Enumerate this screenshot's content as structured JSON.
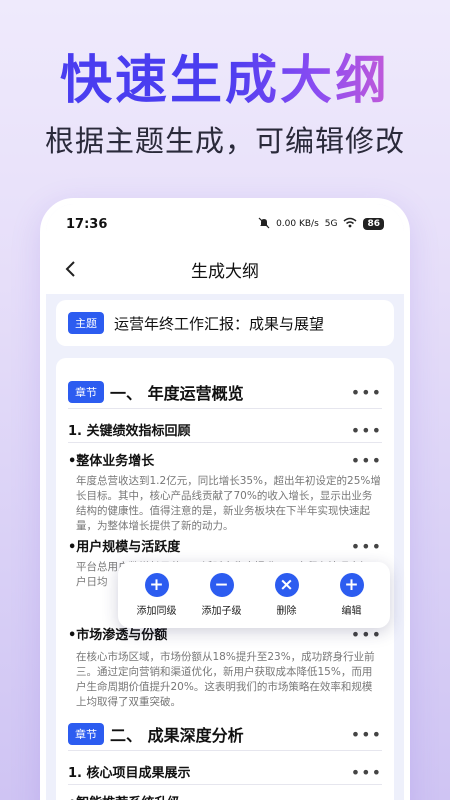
{
  "hero": {
    "title_a": "快速生",
    "title_b": "成大纲",
    "subtitle": "根据主题生成，可编辑修改"
  },
  "status": {
    "time": "17:36",
    "speed": "0.00 KB/s",
    "network": "5G",
    "battery": "86"
  },
  "nav": {
    "title": "生成大纲",
    "back_icon": "chevron-left-icon"
  },
  "topic": {
    "tag": "主题",
    "text": "运营年终工作汇报：成果与展望"
  },
  "outline": {
    "chapter_tag": "章节",
    "more": "•••",
    "chapters": [
      {
        "title": "一、 年度运营概览",
        "sections": [
          {
            "title": "1. 关键绩效指标回顾",
            "items": [
              {
                "title": "•整体业务增长",
                "text": "年度总营收达到1.2亿元，同比增长35%，超出年初设定的25%增长目标。其中，核心产品线贡献了70%的收入增长，显示出业务结构的健康性。值得注意的是，新业务板块在下半年实现快速起量，为整体增长提供了新的动力。"
              },
              {
                "title": "•用户规模与活跃度",
                "text": "平台总用户数增长显著，日活跃率稳步提升，用户留存情况良好，户日均"
              },
              {
                "title": "•市场渗透与份额",
                "text": "在核心市场区域，市场份额从18%提升至23%，成功跻身行业前三。通过定向营销和渠道优化，新用户获取成本降低15%，而用户生命周期价值提升20%。这表明我们的市场策略在效率和规模上均取得了双重突破。"
              }
            ]
          }
        ]
      },
      {
        "title": "二、 成果深度分析",
        "sections": [
          {
            "title": "1. 核心项目成果展示",
            "items": [
              {
                "title": "•智能推荐系统升级",
                "text": ""
              }
            ]
          }
        ]
      }
    ]
  },
  "popup": {
    "items": [
      {
        "label": "添加同级",
        "icon": "plus-icon",
        "glyph": "+"
      },
      {
        "label": "添加子级",
        "icon": "minus-icon",
        "glyph": "−"
      },
      {
        "label": "删除",
        "icon": "close-icon",
        "glyph": "×"
      },
      {
        "label": "编辑",
        "icon": "plus-icon",
        "glyph": "+"
      }
    ]
  },
  "colors": {
    "accent": "#2c5cf0",
    "hero_start": "#4a3df0",
    "hero_end": "#c25ad9"
  }
}
